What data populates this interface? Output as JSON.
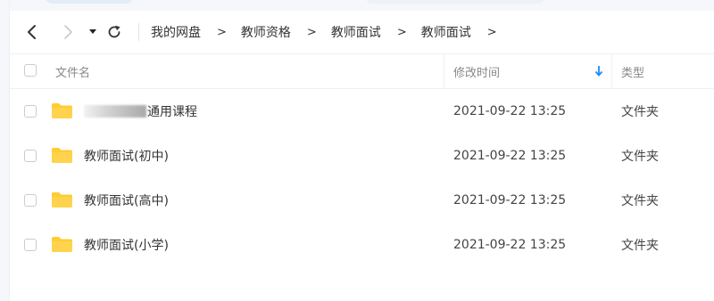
{
  "nav": {
    "back_icon": "chevron-left-icon",
    "forward_icon": "chevron-right-icon",
    "history_icon": "caret-down-icon",
    "refresh_icon": "refresh-icon",
    "breadcrumb": [
      "我的网盘",
      "教师资格",
      "教师面试",
      "教师面试"
    ],
    "separator": ">"
  },
  "table": {
    "headers": {
      "name": "文件名",
      "modified": "修改时间",
      "type": "类型"
    },
    "sort_icon": "arrow-down-icon",
    "sort_color": "#1a8cff",
    "folder_color": "#ffcc33",
    "rows": [
      {
        "name": "通用课程",
        "name_obscured": true,
        "modified": "2021-09-22 13:25",
        "type": "文件夹"
      },
      {
        "name": "教师面试(初中)",
        "name_obscured": false,
        "modified": "2021-09-22 13:25",
        "type": "文件夹"
      },
      {
        "name": "教师面试(高中)",
        "name_obscured": false,
        "modified": "2021-09-22 13:25",
        "type": "文件夹"
      },
      {
        "name": "教师面试(小学)",
        "name_obscured": false,
        "modified": "2021-09-22 13:25",
        "type": "文件夹"
      }
    ]
  }
}
